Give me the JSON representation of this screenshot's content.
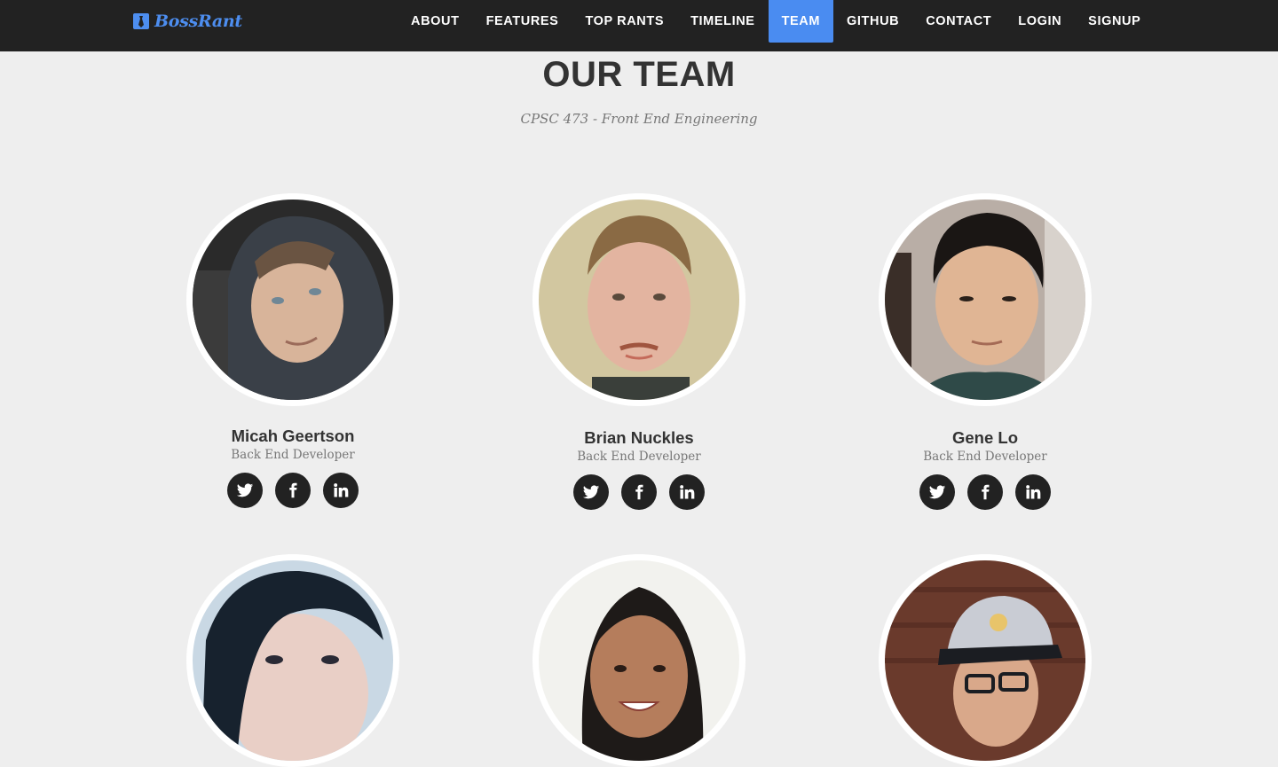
{
  "nav": {
    "brand": "BossRant",
    "brand_icon": "tie-logo-icon",
    "items": [
      {
        "label": "ABOUT",
        "active": false
      },
      {
        "label": "FEATURES",
        "active": false
      },
      {
        "label": "TOP RANTS",
        "active": false
      },
      {
        "label": "TIMELINE",
        "active": false
      },
      {
        "label": "TEAM",
        "active": true
      },
      {
        "label": "GITHUB",
        "active": false
      },
      {
        "label": "CONTACT",
        "active": false
      },
      {
        "label": "LOGIN",
        "active": false
      },
      {
        "label": "SIGNUP",
        "active": false
      }
    ]
  },
  "team": {
    "title": "OUR TEAM",
    "subtitle": "CPSC 473 - Front End Engineering",
    "members": [
      {
        "name": "Micah Geertson",
        "role": "Back End Developer",
        "socials": [
          "twitter-icon",
          "facebook-icon",
          "linkedin-icon"
        ]
      },
      {
        "name": "Brian Nuckles",
        "role": "Back End Developer",
        "socials": [
          "twitter-icon",
          "facebook-icon",
          "linkedin-icon"
        ]
      },
      {
        "name": "Gene Lo",
        "role": "Back End Developer",
        "socials": [
          "twitter-icon",
          "facebook-icon",
          "linkedin-icon"
        ]
      },
      {
        "name": "",
        "role": "",
        "socials": []
      },
      {
        "name": "",
        "role": "",
        "socials": []
      },
      {
        "name": "",
        "role": "",
        "socials": []
      }
    ]
  },
  "colors": {
    "nav_bg": "#222222",
    "accent": "#4a8cf1",
    "page_bg": "#eeeeee",
    "heading": "#333333",
    "muted": "#777777"
  }
}
